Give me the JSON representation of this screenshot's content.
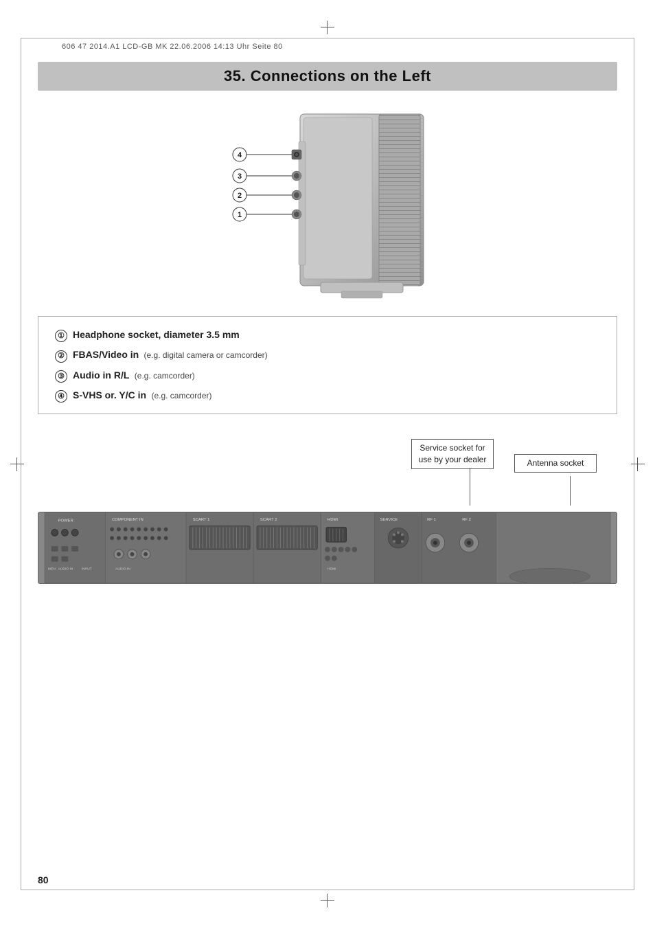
{
  "page": {
    "number": "80",
    "header_meta": "606 47 2014.A1 LCD-GB MK 22.06.2006 14:13 Uhr Seite 80"
  },
  "section": {
    "title": "35. Connections on the Left"
  },
  "callout_labels": {
    "label1": "①",
    "label2": "②",
    "label3": "③",
    "label4": "④"
  },
  "descriptions": [
    {
      "num": "①",
      "label": "Headphone socket, diameter 3.5 mm",
      "note": ""
    },
    {
      "num": "②",
      "label": "FBAS/Video in",
      "note": "(e.g. digital camera or camcorder)"
    },
    {
      "num": "③",
      "label": "Audio in   R/L",
      "note": "(e.g. camcorder)"
    },
    {
      "num": "④",
      "label": "S-VHS or. Y/C in",
      "note": "(e.g. camcorder)"
    }
  ],
  "callouts": {
    "service_socket": {
      "label_line1": "Service socket for",
      "label_line2": "use by your dealer"
    },
    "antenna_socket": {
      "label": "Antenna socket"
    }
  },
  "panel_labels": {
    "component_in": "COMPONENT IN",
    "hdmi": "HDMI",
    "scart1": "SCART 1",
    "scart2": "SCART 2",
    "service": "SERVICE",
    "rf1": "RF 1",
    "rf2": "RF 2"
  }
}
